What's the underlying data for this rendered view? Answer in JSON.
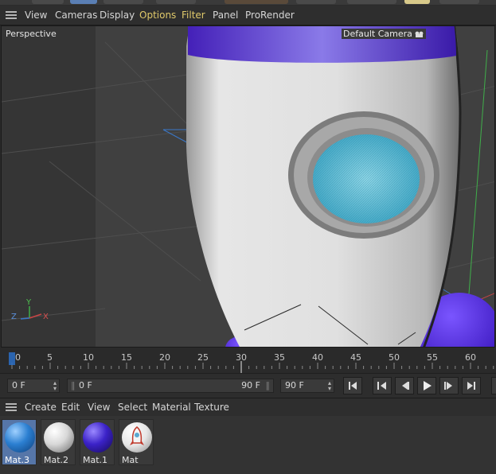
{
  "menubar": {
    "items": [
      "View",
      "Cameras",
      "Display",
      "Options",
      "Filter",
      "Panel",
      "ProRender"
    ],
    "highlight_color": "#e0c96a"
  },
  "viewport": {
    "view_name": "Perspective",
    "camera_label": "Default Camera",
    "axis": {
      "x": "X",
      "y": "Y",
      "z": "Z"
    },
    "rocket_body_color": "#d9d9d9",
    "rocket_accent_color": "#5533cc",
    "porthole_glass_color": "#4fb7cf"
  },
  "timeline": {
    "ticks": [
      "0",
      "5",
      "10",
      "15",
      "20",
      "25",
      "30",
      "35",
      "40",
      "45",
      "50",
      "55",
      "60"
    ],
    "current_frame": 0
  },
  "transport": {
    "current_frame_field": "0 F",
    "range_start": "0 F",
    "range_end": "90 F",
    "end_frame_field": "90 F",
    "buttons": [
      "go-to-start",
      "step-back",
      "play",
      "step-forward",
      "go-to-end"
    ]
  },
  "material_manager": {
    "menu": [
      "Create",
      "Edit",
      "View",
      "Select",
      "Material",
      "Texture"
    ],
    "materials": [
      {
        "name": "Mat.3",
        "color": "#2b7fd1",
        "selected": true
      },
      {
        "name": "Mat.2",
        "color": "#e6e6e6",
        "selected": false
      },
      {
        "name": "Mat.1",
        "color": "#3b22c8",
        "selected": false
      },
      {
        "name": "Mat",
        "color": "#ffffff",
        "selected": false
      }
    ]
  }
}
